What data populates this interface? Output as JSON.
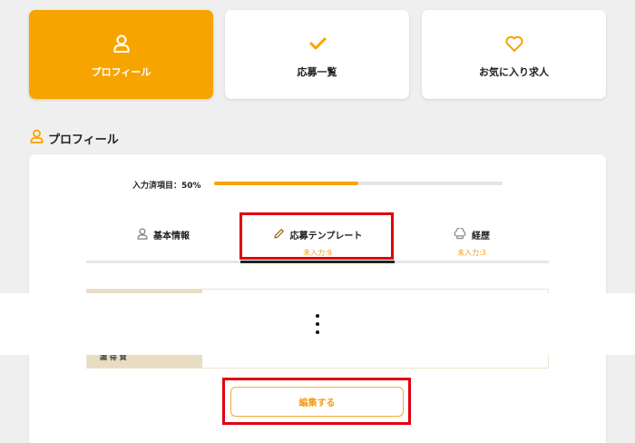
{
  "nav": {
    "cards": [
      {
        "label": "プロフィール",
        "icon": "user-icon",
        "active": true
      },
      {
        "label": "応募一覧",
        "icon": "check-icon",
        "active": false
      },
      {
        "label": "お気に入り求人",
        "icon": "heart-icon",
        "active": false
      }
    ]
  },
  "section": {
    "title": "プロフィール",
    "icon": "user-icon"
  },
  "progress": {
    "label": "入力済項目：50%",
    "percent": 50
  },
  "tabs": [
    {
      "label": "基本情報",
      "sub": "",
      "icon": "user-icon"
    },
    {
      "label": "応募テンプレート",
      "sub": "未入力:9",
      "icon": "pencil-icon"
    },
    {
      "label": "経歴",
      "sub": "未入力:3",
      "icon": "chef-hat-icon"
    }
  ],
  "table": {
    "header_partial": "識 得 資"
  },
  "edit_button": {
    "label": "編集する"
  },
  "colors": {
    "accent": "#f8a400",
    "highlight": "#e0000f"
  }
}
